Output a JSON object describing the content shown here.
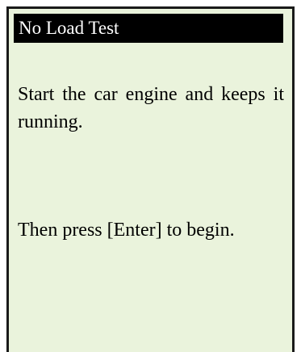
{
  "screen": {
    "title": "No Load Test",
    "instruction_1": "Start the car engine and keeps it running.",
    "instruction_2": "Then press [Enter] to begin."
  },
  "colors": {
    "screen_background": "#eaf3dc",
    "title_background": "#000000",
    "title_text": "#ffffff",
    "text": "#111111",
    "frame": "#1a1a1a"
  }
}
